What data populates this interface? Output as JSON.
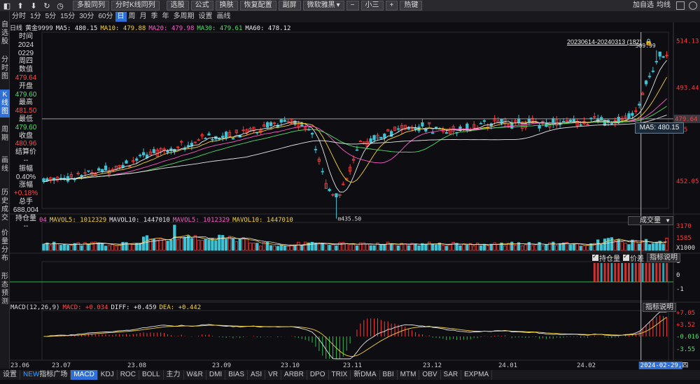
{
  "toolbar": {
    "items": [
      {
        "type": "icon",
        "name": "panel-toggle-icon",
        "glyph": "▮◂"
      },
      {
        "type": "icon",
        "name": "up-arrow-icon",
        "glyph": "⬆"
      },
      {
        "type": "icon",
        "name": "down-arrow-icon",
        "glyph": "⬇"
      },
      {
        "type": "icon",
        "name": "refresh-icon",
        "glyph": "↻"
      },
      {
        "type": "icon",
        "name": "clock-icon",
        "glyph": "◷"
      }
    ],
    "buttons": [
      "多股同列",
      "分时K线同列",
      "选股",
      "公式",
      "换肤",
      "恢复配置",
      "副屏",
      "微软雅黑",
      "小三",
      "热键"
    ],
    "font_dropdown_arrow": "▾",
    "size_minus": "−",
    "size_plus": "+"
  },
  "period_bar": {
    "periods": [
      "分时",
      "1分",
      "5分",
      "15分",
      "30分",
      "60分",
      "日",
      "周",
      "月",
      "季",
      "年",
      "多周期",
      "设置",
      "画线"
    ],
    "active": "日",
    "add_favorite": "加自选",
    "ma_button": "均线"
  },
  "sidebar": {
    "items": [
      "自选股",
      "分时图",
      "K线图",
      "周期",
      "画线",
      "历史成交",
      "价量分布",
      "形态预测"
    ],
    "active": "K线图"
  },
  "legend": {
    "period_label": "日线",
    "symbol": "黄金9999",
    "mas": [
      {
        "label": "MA5:",
        "value": "480.15",
        "color": "#e8e8e8"
      },
      {
        "label": "MA10:",
        "value": "479.88",
        "color": "#f5d23a"
      },
      {
        "label": "MA20:",
        "value": "479.98",
        "color": "#ff5ac8"
      },
      {
        "label": "MA30:",
        "value": "479.61",
        "color": "#4ee06a"
      },
      {
        "label": "MA60:",
        "value": "478.12",
        "color": "#e8e8e8"
      }
    ]
  },
  "info_panel": {
    "rows": [
      {
        "text": "时间",
        "color": "white"
      },
      {
        "text": "2024",
        "color": "white"
      },
      {
        "text": "0229",
        "color": "white"
      },
      {
        "text": "周四",
        "color": "white"
      },
      {
        "text": "数值",
        "color": "white"
      },
      {
        "text": "479.64",
        "color": "red"
      },
      {
        "text": "开盘",
        "color": "white"
      },
      {
        "text": "479.60",
        "color": "green"
      },
      {
        "text": "最高",
        "color": "white"
      },
      {
        "text": "481.50",
        "color": "red"
      },
      {
        "text": "最低",
        "color": "white"
      },
      {
        "text": "479.60",
        "color": "green"
      },
      {
        "text": "收盘",
        "color": "white"
      },
      {
        "text": "480.96",
        "color": "red"
      },
      {
        "text": "结算价",
        "color": "white"
      },
      {
        "text": "--",
        "color": "white"
      },
      {
        "text": "振幅",
        "color": "white"
      },
      {
        "text": "0.40%",
        "color": "white"
      },
      {
        "text": "涨幅",
        "color": "white"
      },
      {
        "text": "+0.18%",
        "color": "red"
      },
      {
        "text": "总手",
        "color": "white"
      },
      {
        "text": "688,004",
        "color": "white"
      },
      {
        "text": "持仓量",
        "color": "white"
      },
      {
        "text": "--",
        "color": "white"
      }
    ]
  },
  "main_chart": {
    "price_axis": [
      "514.13",
      "493.44",
      "475",
      "452.05"
    ],
    "price_axis_values": [
      514.13,
      493.44,
      475,
      452.05
    ],
    "current_price_tag": "479.64",
    "current_price": 479.64,
    "price_range": [
      440,
      518
    ],
    "range_label": "20230614-20240313 (182)",
    "high_marker": "509.99",
    "low_marker": "435.50",
    "tooltip": "MA5: 480.15",
    "colors": {
      "up": "#ff3b3b",
      "down": "#3ec3d4",
      "ma5": "#e8e8e8",
      "ma10": "#f5d23a",
      "ma20": "#ff5ac8",
      "ma30": "#4ee06a",
      "ma60": "#e8e8e8"
    }
  },
  "volume": {
    "legend_prefix": "04",
    "items": [
      {
        "label": "MAVOL5:",
        "value": "1012329",
        "color": "#f5d23a"
      },
      {
        "label": "MAVOL10:",
        "value": "1447010",
        "color": "#e8e8e8"
      },
      {
        "label": "MAVOL5:",
        "value": "1012329",
        "color": "#ff5ac8"
      },
      {
        "label": "MAVOL10:",
        "value": "1447010",
        "color": "#f5d23a"
      }
    ],
    "dropdown": "成交量",
    "axis": [
      "3170",
      "1585",
      "X1000"
    ]
  },
  "open_interest": {
    "checkbox_oi": "持仓量",
    "checkbox_spread": "价差",
    "explain_button": "指标说明",
    "axis": [
      "1",
      "0",
      "-1"
    ]
  },
  "macd": {
    "title": "MACD(12,26,9)",
    "items": [
      {
        "label": "MACD:",
        "value": "+0.034",
        "color": "#ff4b4b"
      },
      {
        "label": "DIFF:",
        "value": "+0.459",
        "color": "#e8e8e8"
      },
      {
        "label": "DEA:",
        "value": "+0.442",
        "color": "#f5d23a"
      }
    ],
    "explain_button": "指标说明",
    "axis": [
      "+7.05",
      "+3.52",
      "-0.016",
      "-3.55"
    ]
  },
  "time_axis": {
    "labels": [
      "23.06",
      "23.07",
      "23.08",
      "23.09",
      "23.10",
      "23.11",
      "23.12",
      "24.01",
      "24.02"
    ],
    "cursor_label": "2024-02-29,四"
  },
  "bottom_tabs": {
    "settings": "设置",
    "new_tag": "NEW",
    "square": "指标广场",
    "tabs": [
      "MACD",
      "KDJ",
      "ROC",
      "BOLL",
      "主力",
      "W&R",
      "DMI",
      "BIAS",
      "ASI",
      "VR",
      "ARBR",
      "DPO",
      "TRIX",
      "新DMA",
      "BBI",
      "MTM",
      "OBV",
      "SAR",
      "EXPMA"
    ],
    "active": "MACD"
  }
}
